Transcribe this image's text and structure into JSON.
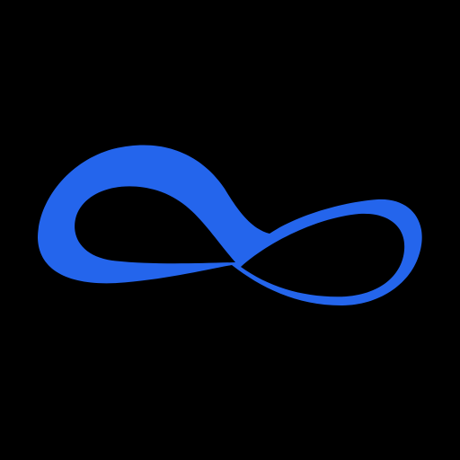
{
  "app": {
    "logo": {
      "icon": "infinity-icon",
      "color": "#2465EC",
      "background": "#000000"
    }
  }
}
